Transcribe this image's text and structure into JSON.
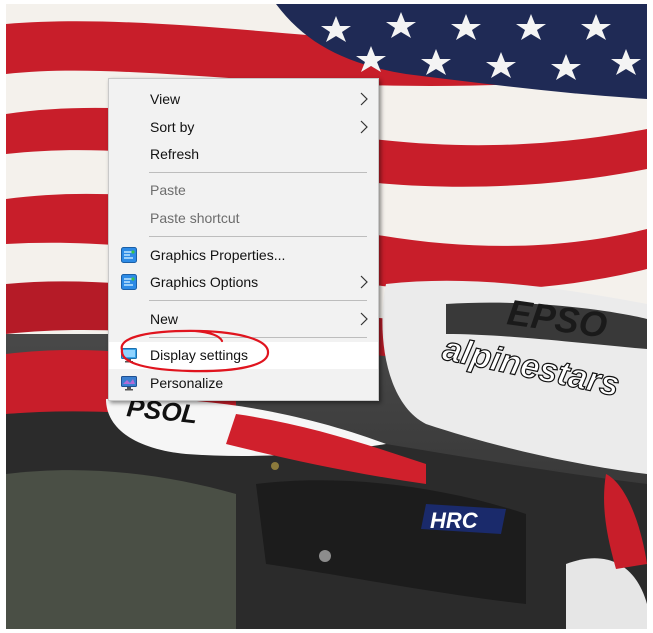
{
  "context_menu": {
    "items": [
      {
        "label": "View",
        "submenu": true,
        "enabled": true
      },
      {
        "label": "Sort by",
        "submenu": true,
        "enabled": true
      },
      {
        "label": "Refresh",
        "submenu": false,
        "enabled": true
      },
      {
        "label": "Paste",
        "submenu": false,
        "enabled": false
      },
      {
        "label": "Paste shortcut",
        "submenu": false,
        "enabled": false
      },
      {
        "label": "Graphics Properties...",
        "submenu": false,
        "enabled": true,
        "icon": "intel-graphics-icon"
      },
      {
        "label": "Graphics Options",
        "submenu": true,
        "enabled": true,
        "icon": "intel-graphics-icon"
      },
      {
        "label": "New",
        "submenu": true,
        "enabled": true
      },
      {
        "label": "Display settings",
        "submenu": false,
        "enabled": true,
        "icon": "display-settings-icon",
        "highlighted": true
      },
      {
        "label": "Personalize",
        "submenu": false,
        "enabled": true,
        "icon": "personalize-icon"
      }
    ]
  },
  "wallpaper": {
    "text": {
      "sponsor": "EPSO",
      "brand": "alpinestars",
      "side": "PSOL",
      "team": "HRC"
    }
  },
  "colors": {
    "menu_bg": "#f2f2f2",
    "annotation": "#e0141e",
    "flag_red": "#c81e2a",
    "flag_blue": "#1f2a55"
  }
}
